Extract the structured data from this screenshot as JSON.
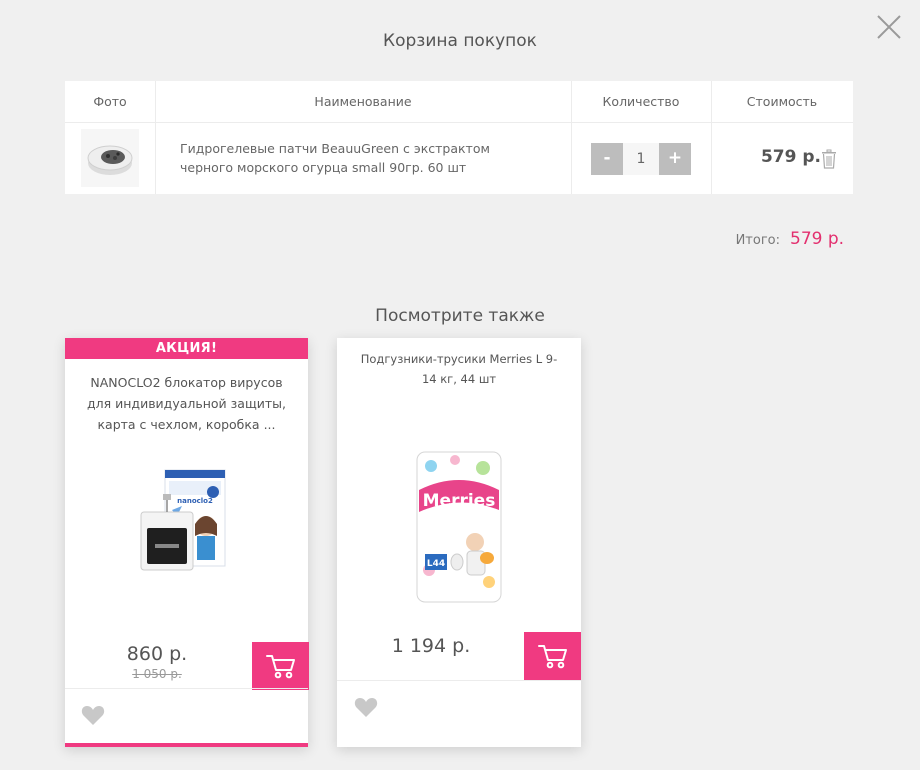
{
  "modal": {
    "title": "Корзина покупок",
    "close_icon": "close-icon"
  },
  "table": {
    "headers": {
      "photo": "Фото",
      "name": "Наименование",
      "qty": "Количество",
      "cost": "Стоимость"
    },
    "rows": [
      {
        "name": "Гидрогелевые патчи BeauuGreen с экстрактом черного морского огурца small 90гр. 60 шт",
        "qty_minus": "-",
        "qty": "1",
        "qty_plus": "+",
        "price": "579 р."
      }
    ]
  },
  "total": {
    "label": "Итого:",
    "value": "579 р."
  },
  "recommend": {
    "title": "Посмотрите также",
    "items": [
      {
        "badge": "АКЦИЯ!",
        "name": "NANOCLO2 блокатор вирусов для индивидуальной защиты, карта с чехлом, коробка ...",
        "image_text": "nanoclo2",
        "price": "860 р.",
        "old_price": "1 050 р."
      },
      {
        "name": "Подгузники-трусики Merries L 9-14 кг, 44 шт",
        "image_text": "Merries",
        "image_badge": "L44",
        "price": "1 194 р."
      }
    ]
  },
  "colors": {
    "accent": "#f03a81",
    "total": "#e3306f",
    "qty_button": "#bdbdbd",
    "background": "#f0f0f0"
  }
}
